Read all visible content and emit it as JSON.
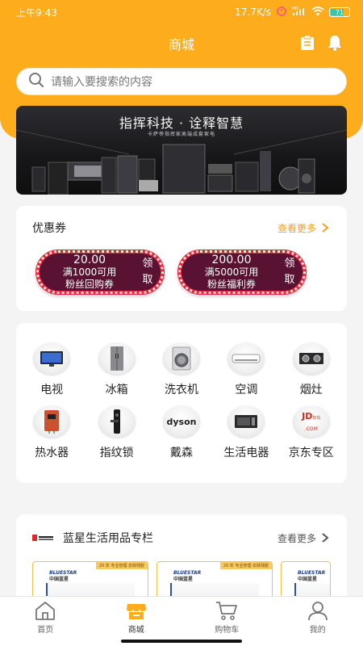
{
  "status": {
    "time": "上午9:43",
    "speed": "17.7K/s",
    "network": "HD",
    "battery": "71"
  },
  "header": {
    "title": "商城"
  },
  "search": {
    "placeholder": "请输入要搜索的内容"
  },
  "banner": {
    "title": "指挥科技 · 诠释智慧",
    "subtitle": "卡萨帝指挥家高端成套家电"
  },
  "coupons": {
    "title": "优惠券",
    "more": "查看更多",
    "items": [
      {
        "amount": "20.00",
        "condition": "满1000可用",
        "desc": "粉丝回购券",
        "action": "领取"
      },
      {
        "amount": "200.00",
        "condition": "满5000可用",
        "desc": "粉丝福利券",
        "action": "领取"
      }
    ]
  },
  "categories": [
    {
      "label": "电视",
      "icon": "tv-icon"
    },
    {
      "label": "冰箱",
      "icon": "fridge-icon"
    },
    {
      "label": "洗衣机",
      "icon": "washer-icon"
    },
    {
      "label": "空调",
      "icon": "aircon-icon"
    },
    {
      "label": "烟灶",
      "icon": "stove-icon"
    },
    {
      "label": "热水器",
      "icon": "water-heater-icon"
    },
    {
      "label": "指纹锁",
      "icon": "fingerprint-lock-icon"
    },
    {
      "label": "戴森",
      "icon": "dyson-logo",
      "logo_text": "dyson"
    },
    {
      "label": "生活电器",
      "icon": "microwave-icon"
    },
    {
      "label": "京东专区",
      "icon": "jd-logo",
      "logo_text": "JD",
      "logo_sub": "京东",
      "logo_domain": ".COM"
    }
  ],
  "section": {
    "title": "蓝星生活用品专栏",
    "more": "查看更多",
    "brand_logo": "蓝星集团",
    "products": [
      {
        "brand": "BLUESTAR",
        "brand_cn": "中国蓝星",
        "tag": "20 年 专业管理·去除残胶"
      },
      {
        "brand": "BLUESTAR",
        "brand_cn": "中国蓝星",
        "tag": "20 年 专业管理·去除残胶"
      },
      {
        "brand": "BLUESTAR",
        "brand_cn": "中国蓝星",
        "tag": ""
      }
    ]
  },
  "tabbar": [
    {
      "label": "首页",
      "icon": "home-icon"
    },
    {
      "label": "商城",
      "icon": "shop-icon",
      "active": true
    },
    {
      "label": "购物车",
      "icon": "cart-icon"
    },
    {
      "label": "我的",
      "icon": "user-icon"
    }
  ],
  "colors": {
    "primary": "#fdac1b",
    "coupon_red": "#e8224a",
    "coupon_dark": "#5a1232"
  }
}
